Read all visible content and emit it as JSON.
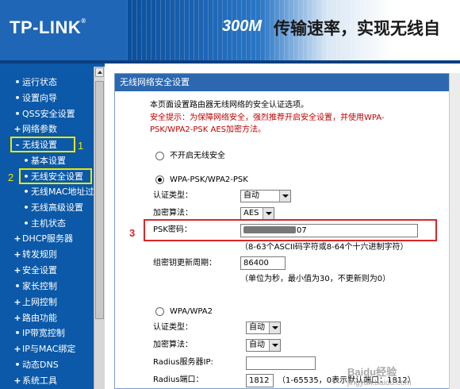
{
  "header": {
    "logo": "TP-LINK",
    "logo_mark": "®",
    "slogan_num": "300M",
    "slogan_text": "传输速率，实现无线自"
  },
  "sidebar": {
    "items": [
      {
        "label": "运行状态",
        "bullet": "•"
      },
      {
        "label": "设置向导",
        "bullet": "•"
      },
      {
        "label": "QSS安全设置",
        "bullet": "•"
      },
      {
        "label": "网络参数",
        "bullet": "+"
      },
      {
        "label": "无线设置",
        "bullet": "-"
      },
      {
        "label": "基本设置",
        "bullet": "•"
      },
      {
        "label": "无线安全设置",
        "bullet": "•"
      },
      {
        "label": "无线MAC地址过滤",
        "bullet": "•"
      },
      {
        "label": "无线高级设置",
        "bullet": "•"
      },
      {
        "label": "主机状态",
        "bullet": "•"
      },
      {
        "label": "DHCP服务器",
        "bullet": "+"
      },
      {
        "label": "转发规则",
        "bullet": "+"
      },
      {
        "label": "安全设置",
        "bullet": "+"
      },
      {
        "label": "家长控制",
        "bullet": "•"
      },
      {
        "label": "上网控制",
        "bullet": "+"
      },
      {
        "label": "路由功能",
        "bullet": "+"
      },
      {
        "label": "IP带宽控制",
        "bullet": "•"
      },
      {
        "label": "IP与MAC绑定",
        "bullet": "+"
      },
      {
        "label": "动态DNS",
        "bullet": "•"
      },
      {
        "label": "系统工具",
        "bullet": "+"
      }
    ]
  },
  "annotations": {
    "n1": "1",
    "n2": "2",
    "n3": "3"
  },
  "panel": {
    "title": "无线网络安全设置",
    "intro": "本页面设置路由器无线网络的安全认证选项。",
    "tip_line1": "安全提示：为保障网络安全，强烈推荐开启安全设置，并使用WPA-",
    "tip_line2": "PSK/WPA2-PSK AES加密方法。",
    "opt_none": "不开启无线安全",
    "opt_wpa_psk": "WPA-PSK/WPA2-PSK",
    "auth_type_label": "认证类型：",
    "auth_type_value": "自动",
    "encrypt_label": "加密算法：",
    "encrypt_value": "AES",
    "psk_label": "PSK密码：",
    "psk_value_tail": "07",
    "psk_hint": "（8-63个ASCII码字符或8-64个十六进制字符）",
    "group_key_label": "组密钥更新周期：",
    "group_key_value": "86400",
    "group_key_hint": "（单位为秒，最小值为30，不更新则为0）",
    "opt_wpa": "WPA/WPA2",
    "auth_type2_label": "认证类型：",
    "auth_type2_value": "自动",
    "encrypt2_label": "加密算法：",
    "encrypt2_value": "自动",
    "radius_ip_label": "Radius服务器IP:",
    "radius_ip_value": "",
    "radius_port_label": "Radius端口：",
    "radius_port_value": "1812",
    "radius_port_hint": "（1-65535，0表示默认端口：1812）"
  },
  "watermark": {
    "brand": "Baidu经验",
    "url": "jingyan.baidu.com"
  },
  "colors": {
    "sidebar_bg": "#0b59a8",
    "title_bar": "#2b68b0",
    "tip_red": "#c00000",
    "highlight_yellow": "#e8e800",
    "highlight_red": "#d8262c"
  }
}
